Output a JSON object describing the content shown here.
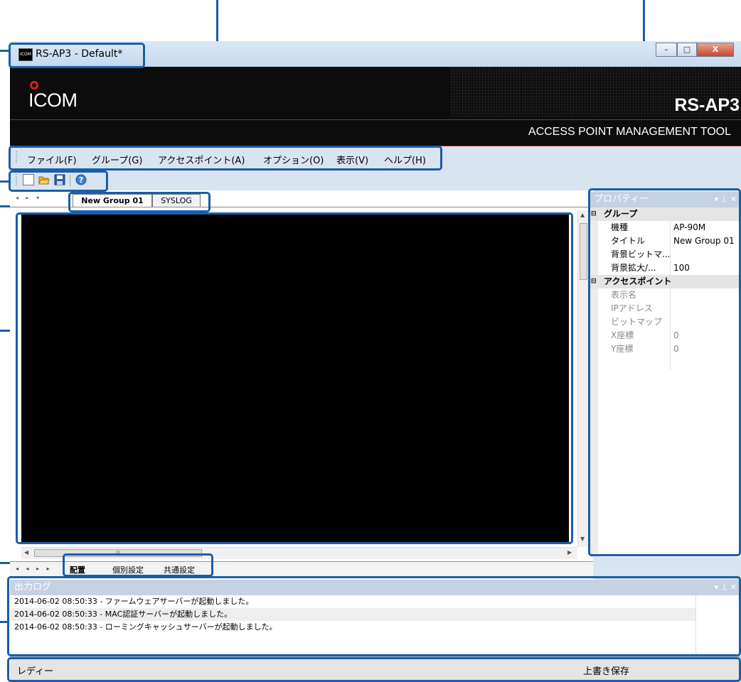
{
  "window": {
    "title": "RS-AP3 - Default*",
    "app_icon_text": "ICOM",
    "controls": {
      "minimize": "–",
      "maximize": "□",
      "close": "X"
    }
  },
  "banner": {
    "logo": "ICOM",
    "product_name": "RS-AP3",
    "subtitle": "ACCESS POINT MANAGEMENT TOOL"
  },
  "menu": {
    "items": [
      {
        "label": "ファイル(F)"
      },
      {
        "label": "グループ(G)"
      },
      {
        "label": "アクセスポイント(A)"
      },
      {
        "label": "オプション(O)"
      },
      {
        "label": "表示(V)"
      },
      {
        "label": "ヘルプ(H)"
      }
    ]
  },
  "toolbar": {
    "icons": [
      "new-file-icon",
      "open-folder-icon",
      "save-icon",
      "help-icon"
    ]
  },
  "document": {
    "tabs": [
      {
        "label": "New Group 01",
        "active": true
      },
      {
        "label": "SYSLOG",
        "active": false
      }
    ],
    "hscroll_marker": "III",
    "bottom_tabs": [
      {
        "label": "配置",
        "active": true
      },
      {
        "label": "個別設定",
        "active": false
      },
      {
        "label": "共通設定",
        "active": false
      }
    ]
  },
  "properties": {
    "title": "プロパティー",
    "header_controls": "▾ ⊥ ✕",
    "categories": [
      {
        "label": "グループ",
        "rows": [
          {
            "name": "機種",
            "value": "AP-90M",
            "enabled": true
          },
          {
            "name": "タイトル",
            "value": "New Group 01",
            "enabled": true
          },
          {
            "name": "背景ビットマ...",
            "value": "",
            "enabled": true
          },
          {
            "name": "背景拡大/...",
            "value": "100",
            "enabled": true
          }
        ]
      },
      {
        "label": "アクセスポイント",
        "rows": [
          {
            "name": "表示名",
            "value": "",
            "enabled": false
          },
          {
            "name": "IPアドレス",
            "value": "",
            "enabled": false
          },
          {
            "name": "ビットマップ",
            "value": "",
            "enabled": false
          },
          {
            "name": "X座標",
            "value": "0",
            "enabled": false
          },
          {
            "name": "Y座標",
            "value": "0",
            "enabled": false
          }
        ]
      }
    ]
  },
  "output": {
    "title": "出力ログ",
    "header_controls": "▾ ⊥ ✕",
    "lines": [
      "2014-06-02 08:50:33 - ファームウェアサーバーが起動しました。",
      "2014-06-02 08:50:33 - MAC認証サーバーが起動しました。",
      "2014-06-02 08:50:33 - ローミングキャッシュサーバーが起動しました。"
    ]
  },
  "status": {
    "left": "レディー",
    "right": "上書き保存"
  },
  "colors": {
    "callout": "#1a5ea8",
    "window_bg": "#d9e4f1",
    "banner_bg": "#0c0c0c",
    "logo_red": "#d81e1e",
    "panel_header": "#c5d2e3",
    "canvas": "#000000"
  }
}
